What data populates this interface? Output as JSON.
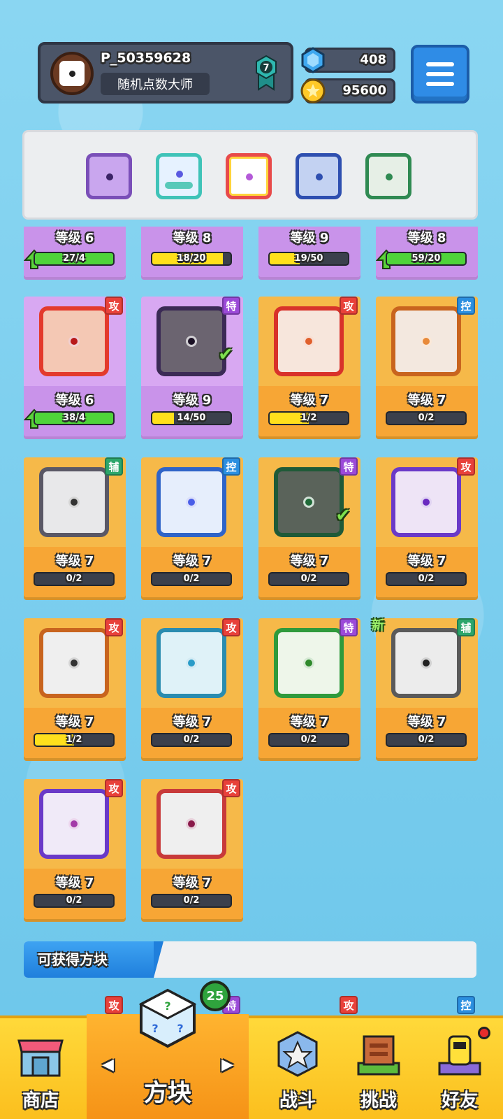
{
  "header": {
    "player_name": "P_50359628",
    "player_title": "随机点数大师",
    "rank_level": "7",
    "gems": "408",
    "coins": "95600"
  },
  "colors": {
    "tag_attack": "#e8413a",
    "tag_special": "#9b4ad8",
    "tag_control": "#2b8fe0",
    "tag_support": "#2ca66b",
    "bar_green": "#4fd43a",
    "bar_yellow": "#ffe01c"
  },
  "deck": {
    "slots": [
      "purple-cracked-dice",
      "hands-dice",
      "rainbow-dice",
      "gear-dice",
      "green-dragon-dice"
    ]
  },
  "cards_top_row": [
    {
      "level": "等级 6",
      "progress": "27/4",
      "upgrade": true
    },
    {
      "level": "等级 8",
      "progress": "18/20"
    },
    {
      "level": "等级 9",
      "progress": "19/50"
    },
    {
      "level": "等级 8",
      "progress": "59/20",
      "upgrade": true
    }
  ],
  "cards": [
    {
      "tag": "攻",
      "level": "等级 6",
      "progress": "38/4",
      "upgrade": true
    },
    {
      "tag": "特",
      "level": "等级 9",
      "progress": "14/50"
    },
    {
      "tag": "攻",
      "level": "等级 7",
      "progress": "1/2"
    },
    {
      "tag": "控",
      "level": "等级 7",
      "progress": "0/2"
    },
    {
      "tag": "辅",
      "level": "等级 7",
      "progress": "0/2"
    },
    {
      "tag": "控",
      "level": "等级 7",
      "progress": "0/2"
    },
    {
      "tag": "特",
      "level": "等级 7",
      "progress": "0/2"
    },
    {
      "tag": "攻",
      "level": "等级 7",
      "progress": "0/2"
    },
    {
      "tag": "攻",
      "level": "等级 7",
      "progress": "1/2"
    },
    {
      "tag": "攻",
      "level": "等级 7",
      "progress": "0/2"
    },
    {
      "tag": "特",
      "level": "等级 7",
      "progress": "0/2"
    },
    {
      "tag": "辅",
      "level": "等级 7",
      "progress": "0/2",
      "new": "新"
    },
    {
      "tag": "攻",
      "level": "等级 7",
      "progress": "0/2"
    },
    {
      "tag": "攻",
      "level": "等级 7",
      "progress": "0/2"
    }
  ],
  "obtainable": {
    "label": "可获得方块",
    "tags": [
      "攻",
      "特",
      "攻",
      "控"
    ]
  },
  "nav": {
    "shop": "商店",
    "dice": "方块",
    "dice_badge": "25",
    "battle": "战斗",
    "challenge": "挑战",
    "friends": "好友"
  }
}
